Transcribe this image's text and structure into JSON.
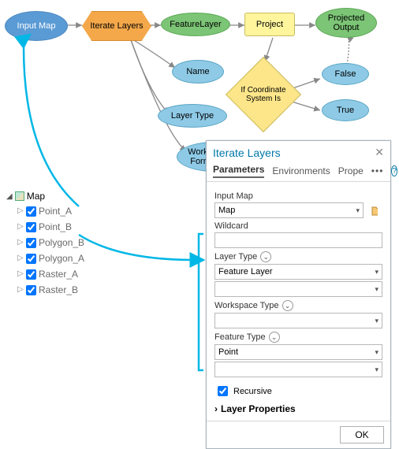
{
  "flow": {
    "input_map": "Input Map",
    "iterate_layers": "Iterate Layers",
    "feature_layer": "FeatureLayer",
    "project": "Project",
    "projected_output": "Projected\nOutput",
    "name": "Name",
    "if_coord": "If Coordinate\nSystem Is",
    "false": "False",
    "true": "True",
    "layer_type": "Layer Type",
    "workspace_type": "Workspace or\nFormat Type"
  },
  "toc": {
    "root": "Map",
    "items": [
      {
        "label": "Point_A",
        "checked": true
      },
      {
        "label": "Point_B",
        "checked": true
      },
      {
        "label": "Polygon_B",
        "checked": true
      },
      {
        "label": "Polygon_A",
        "checked": true
      },
      {
        "label": "Raster_A",
        "checked": true
      },
      {
        "label": "Raster_B",
        "checked": true
      }
    ]
  },
  "panel": {
    "title": "Iterate Layers",
    "tabs": {
      "parameters": "Parameters",
      "environments": "Environments",
      "properties": "Prope"
    },
    "more": "•••",
    "help": "?",
    "input_map_label": "Input Map",
    "input_map_value": "Map",
    "wildcard_label": "Wildcard",
    "wildcard_value": "",
    "layer_type_label": "Layer Type",
    "layer_type_value": "Feature Layer",
    "layer_type_extra": "",
    "workspace_type_label": "Workspace Type",
    "workspace_type_value": "",
    "feature_type_label": "Feature Type",
    "feature_type_value": "Point",
    "feature_type_extra": "",
    "recursive_label": "Recursive",
    "recursive_checked": true,
    "layer_props": "Layer Properties",
    "ok": "OK"
  }
}
